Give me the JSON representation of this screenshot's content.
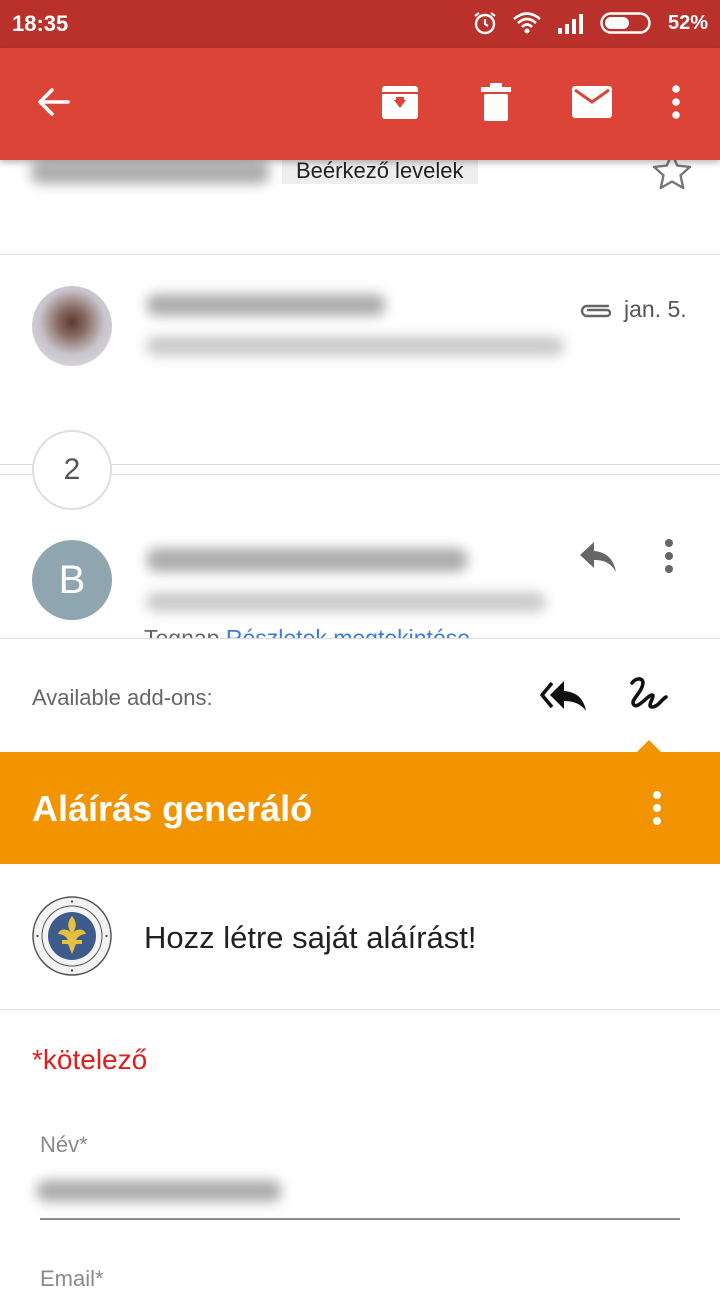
{
  "status_bar": {
    "time": "18:35",
    "battery": "52%"
  },
  "app_bar": {
    "back_icon": "arrow-left-icon",
    "archive_icon": "archive-icon",
    "delete_icon": "trash-icon",
    "mark_unread_icon": "mail-icon",
    "more_icon": "more-vert-icon"
  },
  "thread": {
    "label_chip": "Beérkező levelek",
    "messages": [
      {
        "date": "jan. 5.",
        "has_attachment": true
      },
      {
        "avatar_letter": "B",
        "time": "Tegnap",
        "details_link": "Részletek megtekintése"
      }
    ],
    "collapsed_count": "2"
  },
  "addons": {
    "label": "Available add-ons:",
    "title": "Aláírás generáló",
    "prompt": "Hozz létre saját aláírást!",
    "required_note": "*kötelező",
    "fields": [
      {
        "label": "Név*"
      },
      {
        "label": "Email*"
      }
    ],
    "accent_color": "#f29400"
  },
  "colors": {
    "app_bar": "#db4437",
    "status_bar": "#b9312a",
    "link": "#3b7be0",
    "required": "#e21b1b"
  }
}
